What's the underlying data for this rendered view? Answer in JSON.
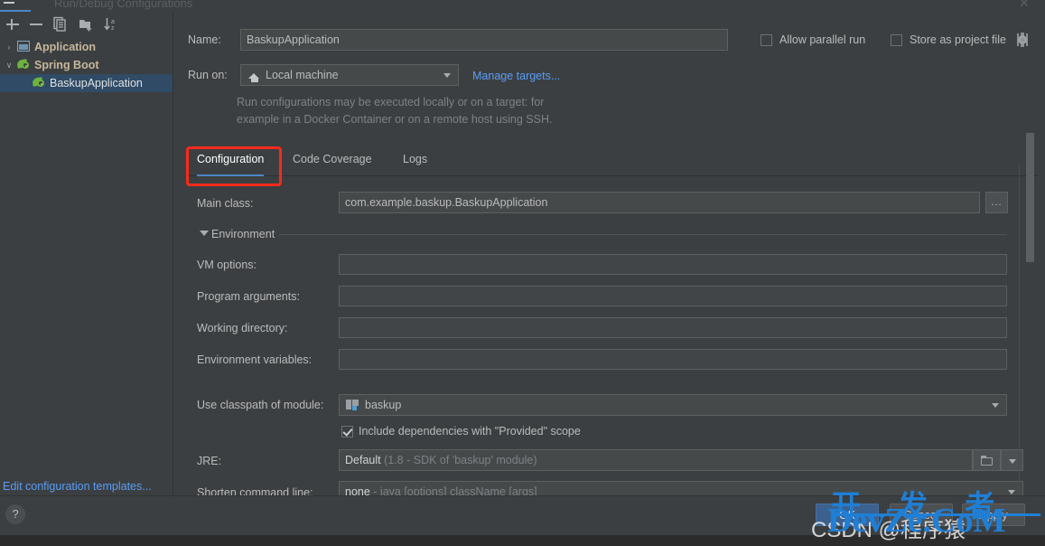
{
  "window": {
    "title": "Run/Debug Configurations",
    "close_label": "✕"
  },
  "sidebar": {
    "toolbar": [
      {
        "name": "add-configuration",
        "label": "+"
      },
      {
        "name": "remove-configuration",
        "label": "−"
      },
      {
        "name": "copy-configuration",
        "label": "copy"
      },
      {
        "name": "new-folder",
        "label": "folder"
      },
      {
        "name": "sort-alphabetically",
        "label": "sort"
      }
    ],
    "tree": [
      {
        "label": "Application",
        "arrow": "›",
        "icon": "application-icon",
        "selected": false
      },
      {
        "label": "Spring Boot",
        "arrow": "∨",
        "icon": "spring-boot-icon",
        "selected": false
      },
      {
        "label": "BaskupApplication",
        "arrow": "",
        "icon": "spring-boot-icon",
        "selected": true
      }
    ],
    "edit_templates_link": "Edit configuration templates..."
  },
  "form": {
    "name_label": "Name:",
    "name_value": "BaskupApplication",
    "run_on_label": "Run on:",
    "run_on_value": "Local machine",
    "manage_targets_link": "Manage targets...",
    "hint_line1": "Run configurations may be executed locally or on a target: for",
    "hint_line2": "example in a Docker Container or on a remote host using SSH.",
    "allow_parallel_run": "Allow parallel run",
    "allow_parallel_run_checked": false,
    "store_as_project_file": "Store as project file",
    "store_as_project_file_checked": false
  },
  "tabs": [
    {
      "label": "Configuration",
      "active": true,
      "highlighted": true
    },
    {
      "label": "Code Coverage",
      "active": false,
      "highlighted": false
    },
    {
      "label": "Logs",
      "active": false,
      "highlighted": false
    }
  ],
  "configuration": {
    "main_class_label": "Main class:",
    "main_class_value": "com.example.baskup.BaskupApplication",
    "browse_button": "...",
    "environment_section": "Environment",
    "vm_options_label": "VM options:",
    "vm_options_value": "",
    "program_arguments_label": "Program arguments:",
    "program_arguments_value": "",
    "working_directory_label": "Working directory:",
    "working_directory_value": "",
    "environment_variables_label": "Environment variables:",
    "environment_variables_value": "",
    "use_classpath_label": "Use classpath of module:",
    "use_classpath_value": "baskup",
    "include_provided_label": "Include dependencies with \"Provided\" scope",
    "include_provided_checked": true,
    "jre_label": "JRE:",
    "jre_value": "Default",
    "jre_value_hint": "(1.8 - SDK of 'baskup' module)",
    "shorten_label": "Shorten command line:",
    "shorten_value": "none",
    "shorten_value_hint": "- java [options] className [args]"
  },
  "footer": {
    "help": "?",
    "ok": "OK",
    "cancel": "Cancel",
    "apply": "Apply"
  },
  "watermark": {
    "csdn": "CSDN @程序猿",
    "devze_top": "开 发 者",
    "devze_main": "DevZe.CoM"
  },
  "colors": {
    "accent": "#4a88c7",
    "link": "#589df6",
    "highlight_box": "#f52b1c",
    "primary_button": "#3c618f",
    "selection": "#2f4b66",
    "watermark_blue": "#1f7fd6"
  }
}
